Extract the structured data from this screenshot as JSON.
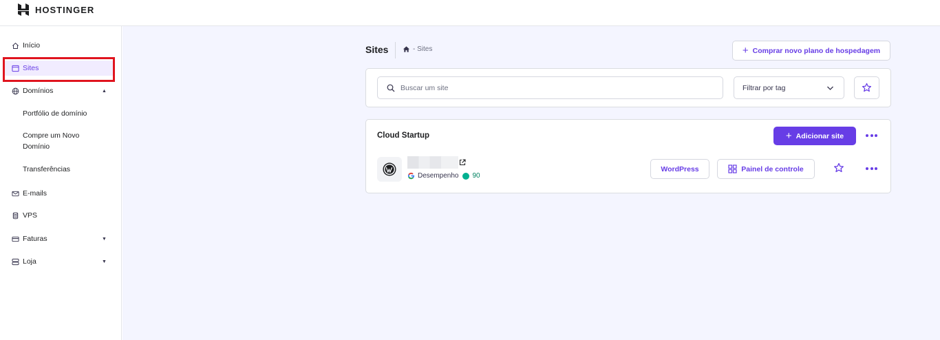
{
  "brand": {
    "name": "HOSTINGER"
  },
  "sidebar": {
    "items": [
      {
        "label": "Início",
        "icon": "home-icon"
      },
      {
        "label": "Sites",
        "icon": "sites-icon",
        "active": true
      },
      {
        "label": "Domínios",
        "icon": "globe-icon",
        "expanded": true
      },
      {
        "label": "E-mails",
        "icon": "mail-icon"
      },
      {
        "label": "VPS",
        "icon": "server-icon"
      },
      {
        "label": "Faturas",
        "icon": "billing-icon"
      },
      {
        "label": "Loja",
        "icon": "store-icon"
      }
    ],
    "domain_subitems": [
      {
        "label": "Portfólio de domínio"
      },
      {
        "label": "Compre um Novo Domínio"
      },
      {
        "label": "Transferências"
      }
    ]
  },
  "header": {
    "title": "Sites",
    "breadcrumb": "- Sites",
    "buy_button": "Comprar novo plano de hospedagem"
  },
  "toolbar": {
    "search_placeholder": "Buscar um site",
    "filter_value": "Filtrar por tag"
  },
  "plan": {
    "name": "Cloud Startup",
    "add_site_button": "Adicionar site",
    "site": {
      "performance_label": "Desempenho",
      "performance_score": "90",
      "wordpress_button": "WordPress",
      "control_panel_button": "Painel de controle"
    }
  },
  "colors": {
    "accent": "#673de6",
    "active_bg": "#f1ecff",
    "highlight": "#e0141e",
    "main_bg": "#f4f5ff",
    "score_green": "#00b090"
  }
}
